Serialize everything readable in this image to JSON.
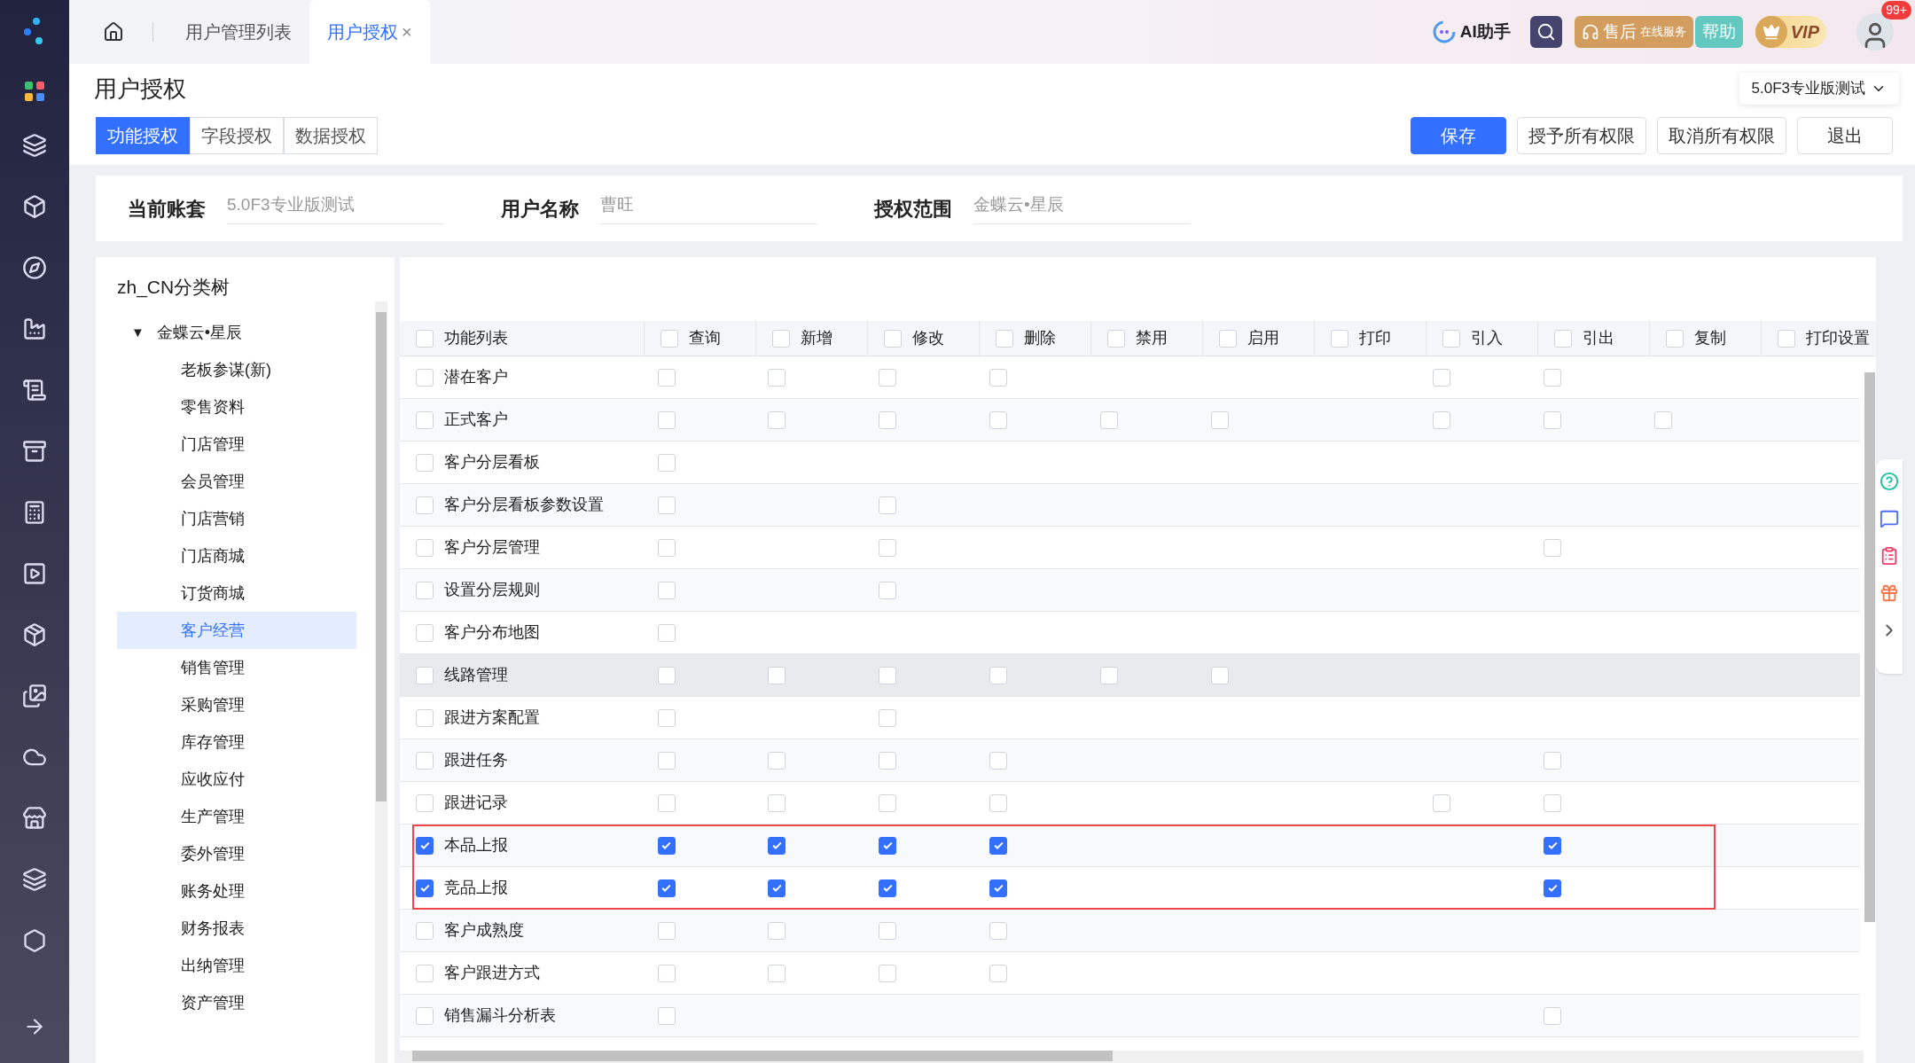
{
  "top_tabs": [
    {
      "label": "用户管理列表",
      "selected": false
    },
    {
      "label": "用户授权",
      "selected": true,
      "close": "×"
    }
  ],
  "top_right": {
    "ai": "AI助手",
    "service": "售后",
    "service_sub": "在线服务",
    "help": "帮助",
    "vip": "VIP",
    "badge": "99+"
  },
  "page_title": "用户授权",
  "account_select": "5.0F3专业版测试",
  "sub_tabs": [
    {
      "label": "功能授权",
      "selected": true
    },
    {
      "label": "字段授权",
      "selected": false
    },
    {
      "label": "数据授权",
      "selected": false
    }
  ],
  "actions": [
    {
      "label": "保存",
      "kind": "primary"
    },
    {
      "label": "授予所有权限",
      "kind": "default"
    },
    {
      "label": "取消所有权限",
      "kind": "default"
    },
    {
      "label": "退出",
      "kind": "default"
    }
  ],
  "info": [
    {
      "label": "当前账套",
      "value": "5.0F3专业版测试"
    },
    {
      "label": "用户名称",
      "value": "曹旺"
    },
    {
      "label": "授权范围",
      "value": "金蝶云•星辰"
    }
  ],
  "tree": {
    "title": "zh_CN分类树",
    "root": {
      "label": "金蝶云•星辰",
      "expanded": true,
      "toggle": "▼",
      "children": [
        {
          "label": "老板参谋(新)",
          "selected": false
        },
        {
          "label": "零售资料",
          "selected": false
        },
        {
          "label": "门店管理",
          "selected": false
        },
        {
          "label": "会员管理",
          "selected": false
        },
        {
          "label": "门店营销",
          "selected": false
        },
        {
          "label": "门店商城",
          "selected": false
        },
        {
          "label": "订货商城",
          "selected": false
        },
        {
          "label": "客户经营",
          "selected": true
        },
        {
          "label": "销售管理",
          "selected": false
        },
        {
          "label": "采购管理",
          "selected": false
        },
        {
          "label": "库存管理",
          "selected": false
        },
        {
          "label": "应收应付",
          "selected": false
        },
        {
          "label": "生产管理",
          "selected": false
        },
        {
          "label": "委外管理",
          "selected": false
        },
        {
          "label": "账务处理",
          "selected": false
        },
        {
          "label": "财务报表",
          "selected": false
        },
        {
          "label": "出纳管理",
          "selected": false
        },
        {
          "label": "资产管理",
          "selected": false
        }
      ]
    }
  },
  "table": {
    "first_column": {
      "label": "功能列表",
      "checked": false
    },
    "columns": [
      {
        "label": "查询",
        "checked": false
      },
      {
        "label": "新增",
        "checked": false
      },
      {
        "label": "修改",
        "checked": false
      },
      {
        "label": "删除",
        "checked": false
      },
      {
        "label": "禁用",
        "checked": false
      },
      {
        "label": "启用",
        "checked": false
      },
      {
        "label": "打印",
        "checked": false
      },
      {
        "label": "引入",
        "checked": false
      },
      {
        "label": "引出",
        "checked": false
      },
      {
        "label": "复制",
        "checked": false
      },
      {
        "label": "打印设置",
        "checked": false
      }
    ],
    "rows": [
      {
        "name": "潜在客户",
        "checked": false,
        "selected": false,
        "highlighted": false,
        "cells": [
          {
            "kind": "checkbox",
            "checked": false
          },
          {
            "kind": "checkbox",
            "checked": false
          },
          {
            "kind": "checkbox",
            "checked": false
          },
          {
            "kind": "checkbox",
            "checked": false
          },
          {
            "kind": "blank"
          },
          {
            "kind": "blank"
          },
          {
            "kind": "blank"
          },
          {
            "kind": "checkbox",
            "checked": false
          },
          {
            "kind": "checkbox",
            "checked": false
          },
          {
            "kind": "blank"
          },
          {
            "kind": "blank"
          }
        ]
      },
      {
        "name": "正式客户",
        "checked": false,
        "selected": false,
        "highlighted": false,
        "cells": [
          {
            "kind": "checkbox",
            "checked": false
          },
          {
            "kind": "checkbox",
            "checked": false
          },
          {
            "kind": "checkbox",
            "checked": false
          },
          {
            "kind": "checkbox",
            "checked": false
          },
          {
            "kind": "checkbox",
            "checked": false
          },
          {
            "kind": "checkbox",
            "checked": false
          },
          {
            "kind": "blank"
          },
          {
            "kind": "checkbox",
            "checked": false
          },
          {
            "kind": "checkbox",
            "checked": false
          },
          {
            "kind": "checkbox",
            "checked": false
          },
          {
            "kind": "blank"
          }
        ]
      },
      {
        "name": "客户分层看板",
        "checked": false,
        "selected": false,
        "highlighted": false,
        "cells": [
          {
            "kind": "checkbox",
            "checked": false
          },
          {
            "kind": "blank"
          },
          {
            "kind": "blank"
          },
          {
            "kind": "blank"
          },
          {
            "kind": "blank"
          },
          {
            "kind": "blank"
          },
          {
            "kind": "blank"
          },
          {
            "kind": "blank"
          },
          {
            "kind": "blank"
          },
          {
            "kind": "blank"
          },
          {
            "kind": "blank"
          }
        ]
      },
      {
        "name": "客户分层看板参数设置",
        "checked": false,
        "selected": false,
        "highlighted": false,
        "cells": [
          {
            "kind": "checkbox",
            "checked": false
          },
          {
            "kind": "blank"
          },
          {
            "kind": "checkbox",
            "checked": false
          },
          {
            "kind": "blank"
          },
          {
            "kind": "blank"
          },
          {
            "kind": "blank"
          },
          {
            "kind": "blank"
          },
          {
            "kind": "blank"
          },
          {
            "kind": "blank"
          },
          {
            "kind": "blank"
          },
          {
            "kind": "blank"
          }
        ]
      },
      {
        "name": "客户分层管理",
        "checked": false,
        "selected": false,
        "highlighted": false,
        "cells": [
          {
            "kind": "checkbox",
            "checked": false
          },
          {
            "kind": "blank"
          },
          {
            "kind": "checkbox",
            "checked": false
          },
          {
            "kind": "blank"
          },
          {
            "kind": "blank"
          },
          {
            "kind": "blank"
          },
          {
            "kind": "blank"
          },
          {
            "kind": "blank"
          },
          {
            "kind": "checkbox",
            "checked": false
          },
          {
            "kind": "blank"
          },
          {
            "kind": "blank"
          }
        ]
      },
      {
        "name": "设置分层规则",
        "checked": false,
        "selected": false,
        "highlighted": false,
        "cells": [
          {
            "kind": "checkbox",
            "checked": false
          },
          {
            "kind": "blank"
          },
          {
            "kind": "checkbox",
            "checked": false
          },
          {
            "kind": "blank"
          },
          {
            "kind": "blank"
          },
          {
            "kind": "blank"
          },
          {
            "kind": "blank"
          },
          {
            "kind": "blank"
          },
          {
            "kind": "blank"
          },
          {
            "kind": "blank"
          },
          {
            "kind": "blank"
          }
        ]
      },
      {
        "name": "客户分布地图",
        "checked": false,
        "selected": false,
        "highlighted": false,
        "cells": [
          {
            "kind": "checkbox",
            "checked": false
          },
          {
            "kind": "blank"
          },
          {
            "kind": "blank"
          },
          {
            "kind": "blank"
          },
          {
            "kind": "blank"
          },
          {
            "kind": "blank"
          },
          {
            "kind": "blank"
          },
          {
            "kind": "blank"
          },
          {
            "kind": "blank"
          },
          {
            "kind": "blank"
          },
          {
            "kind": "blank"
          }
        ]
      },
      {
        "name": "线路管理",
        "checked": false,
        "selected": true,
        "highlighted": false,
        "cells": [
          {
            "kind": "checkbox",
            "checked": false
          },
          {
            "kind": "checkbox",
            "checked": false
          },
          {
            "kind": "checkbox",
            "checked": false
          },
          {
            "kind": "checkbox",
            "checked": false
          },
          {
            "kind": "checkbox",
            "checked": false
          },
          {
            "kind": "checkbox",
            "checked": false
          },
          {
            "kind": "blank"
          },
          {
            "kind": "blank"
          },
          {
            "kind": "blank"
          },
          {
            "kind": "blank"
          },
          {
            "kind": "blank"
          }
        ]
      },
      {
        "name": "跟进方案配置",
        "checked": false,
        "selected": false,
        "highlighted": false,
        "cells": [
          {
            "kind": "checkbox",
            "checked": false
          },
          {
            "kind": "blank"
          },
          {
            "kind": "checkbox",
            "checked": false
          },
          {
            "kind": "blank"
          },
          {
            "kind": "blank"
          },
          {
            "kind": "blank"
          },
          {
            "kind": "blank"
          },
          {
            "kind": "blank"
          },
          {
            "kind": "blank"
          },
          {
            "kind": "blank"
          },
          {
            "kind": "blank"
          }
        ]
      },
      {
        "name": "跟进任务",
        "checked": false,
        "selected": false,
        "highlighted": false,
        "cells": [
          {
            "kind": "checkbox",
            "checked": false
          },
          {
            "kind": "checkbox",
            "checked": false
          },
          {
            "kind": "checkbox",
            "checked": false
          },
          {
            "kind": "checkbox",
            "checked": false
          },
          {
            "kind": "blank"
          },
          {
            "kind": "blank"
          },
          {
            "kind": "blank"
          },
          {
            "kind": "blank"
          },
          {
            "kind": "checkbox",
            "checked": false
          },
          {
            "kind": "blank"
          },
          {
            "kind": "blank"
          }
        ]
      },
      {
        "name": "跟进记录",
        "checked": false,
        "selected": false,
        "highlighted": false,
        "cells": [
          {
            "kind": "checkbox",
            "checked": false
          },
          {
            "kind": "checkbox",
            "checked": false
          },
          {
            "kind": "checkbox",
            "checked": false
          },
          {
            "kind": "checkbox",
            "checked": false
          },
          {
            "kind": "blank"
          },
          {
            "kind": "blank"
          },
          {
            "kind": "blank"
          },
          {
            "kind": "checkbox",
            "checked": false
          },
          {
            "kind": "checkbox",
            "checked": false
          },
          {
            "kind": "blank"
          },
          {
            "kind": "blank"
          }
        ]
      },
      {
        "name": "本品上报",
        "checked": true,
        "selected": false,
        "highlighted": true,
        "cells": [
          {
            "kind": "checkbox",
            "checked": true
          },
          {
            "kind": "checkbox",
            "checked": true
          },
          {
            "kind": "checkbox",
            "checked": true
          },
          {
            "kind": "checkbox",
            "checked": true
          },
          {
            "kind": "blank"
          },
          {
            "kind": "blank"
          },
          {
            "kind": "blank"
          },
          {
            "kind": "blank"
          },
          {
            "kind": "checkbox",
            "checked": true
          },
          {
            "kind": "blank"
          },
          {
            "kind": "blank"
          }
        ]
      },
      {
        "name": "竞品上报",
        "checked": true,
        "selected": false,
        "highlighted": true,
        "cells": [
          {
            "kind": "checkbox",
            "checked": true
          },
          {
            "kind": "checkbox",
            "checked": true
          },
          {
            "kind": "checkbox",
            "checked": true
          },
          {
            "kind": "checkbox",
            "checked": true
          },
          {
            "kind": "blank"
          },
          {
            "kind": "blank"
          },
          {
            "kind": "blank"
          },
          {
            "kind": "blank"
          },
          {
            "kind": "checkbox",
            "checked": true
          },
          {
            "kind": "blank"
          },
          {
            "kind": "blank"
          }
        ]
      },
      {
        "name": "客户成熟度",
        "checked": false,
        "selected": false,
        "highlighted": false,
        "cells": [
          {
            "kind": "checkbox",
            "checked": false
          },
          {
            "kind": "checkbox",
            "checked": false
          },
          {
            "kind": "checkbox",
            "checked": false
          },
          {
            "kind": "checkbox",
            "checked": false
          },
          {
            "kind": "blank"
          },
          {
            "kind": "blank"
          },
          {
            "kind": "blank"
          },
          {
            "kind": "blank"
          },
          {
            "kind": "blank"
          },
          {
            "kind": "blank"
          },
          {
            "kind": "blank"
          }
        ]
      },
      {
        "name": "客户跟进方式",
        "checked": false,
        "selected": false,
        "highlighted": false,
        "cells": [
          {
            "kind": "checkbox",
            "checked": false
          },
          {
            "kind": "checkbox",
            "checked": false
          },
          {
            "kind": "checkbox",
            "checked": false
          },
          {
            "kind": "checkbox",
            "checked": false
          },
          {
            "kind": "blank"
          },
          {
            "kind": "blank"
          },
          {
            "kind": "blank"
          },
          {
            "kind": "blank"
          },
          {
            "kind": "blank"
          },
          {
            "kind": "blank"
          },
          {
            "kind": "blank"
          }
        ]
      },
      {
        "name": "销售漏斗分析表",
        "checked": false,
        "selected": false,
        "highlighted": false,
        "cells": [
          {
            "kind": "checkbox",
            "checked": false
          },
          {
            "kind": "blank"
          },
          {
            "kind": "blank"
          },
          {
            "kind": "blank"
          },
          {
            "kind": "blank"
          },
          {
            "kind": "blank"
          },
          {
            "kind": "blank"
          },
          {
            "kind": "blank"
          },
          {
            "kind": "checkbox",
            "checked": false
          },
          {
            "kind": "blank"
          },
          {
            "kind": "blank"
          }
        ]
      }
    ]
  }
}
